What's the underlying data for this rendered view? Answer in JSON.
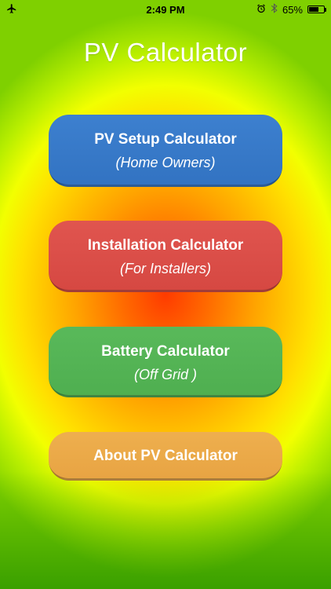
{
  "status_bar": {
    "time": "2:49 PM",
    "battery_percent": "65%",
    "battery_level": 0.65,
    "icons": [
      "airplane-icon",
      "alarm-icon",
      "bluetooth-icon",
      "battery-icon"
    ]
  },
  "app": {
    "title": "PV Calculator"
  },
  "buttons": {
    "pv_setup": {
      "label": "PV Setup Calculator",
      "sub": "(Home Owners)"
    },
    "installation": {
      "label": "Installation Calculator",
      "sub": "(For Installers)"
    },
    "battery": {
      "label": "Battery Calculator",
      "sub": "(Off Grid )"
    },
    "about": {
      "label": "About PV Calculator"
    }
  },
  "colors": {
    "blue": "#3a78c8",
    "red": "#db4e48",
    "green": "#55b455",
    "orange": "#ecaa49"
  }
}
